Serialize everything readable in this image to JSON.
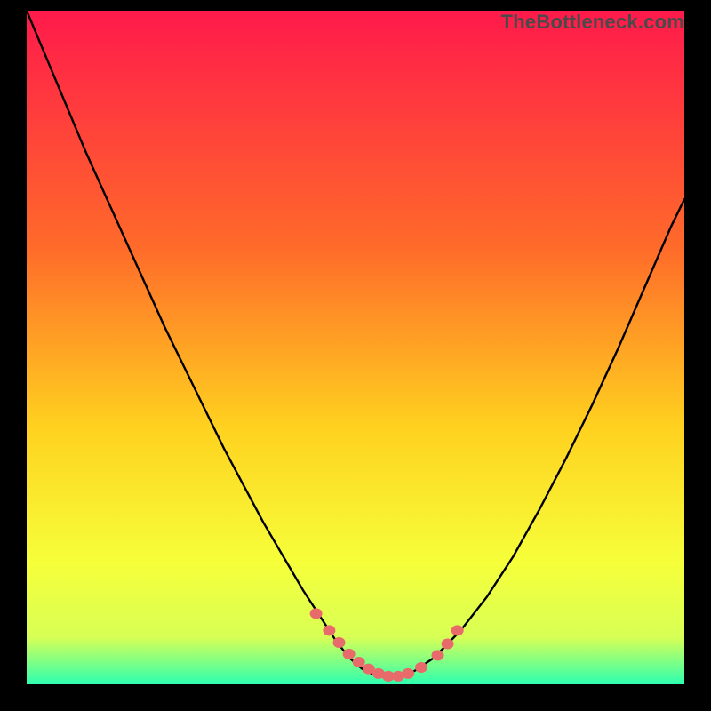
{
  "watermark": "TheBottleneck.com",
  "colors": {
    "gradient_top": "#ff1a4b",
    "gradient_upper_mid": "#ff6a2a",
    "gradient_mid": "#ffd21f",
    "gradient_lower_mid": "#f6ff3a",
    "gradient_near_bottom": "#d8ff55",
    "gradient_bottom": "#2dffb0",
    "curve": "#000000",
    "marker_fill": "#e96a6a",
    "marker_stroke": "#c94f4f"
  },
  "chart_data": {
    "type": "line",
    "title": "",
    "xlabel": "",
    "ylabel": "",
    "xlim": [
      0,
      100
    ],
    "ylim": [
      0,
      100
    ],
    "x": [
      0,
      3,
      6,
      9,
      12,
      15,
      18,
      21,
      24,
      27,
      30,
      33,
      36,
      39,
      42,
      45,
      47,
      49,
      51,
      53,
      55,
      57,
      59,
      62,
      66,
      70,
      74,
      78,
      82,
      86,
      90,
      94,
      98,
      100
    ],
    "y": [
      100,
      93,
      86,
      79,
      72.5,
      66,
      59.5,
      53,
      47,
      41,
      35,
      29.5,
      24,
      19,
      14,
      9.5,
      6.5,
      4,
      2.3,
      1.3,
      1,
      1.2,
      2,
      4,
      8,
      13,
      19,
      26,
      33.5,
      41.5,
      50,
      59,
      68,
      72
    ],
    "markers": {
      "x": [
        44,
        46,
        47.5,
        49,
        50.5,
        52,
        53.5,
        55,
        56.5,
        58,
        60,
        62.5,
        64,
        65.5
      ],
      "y": [
        10.5,
        8,
        6.2,
        4.5,
        3.3,
        2.3,
        1.6,
        1.2,
        1.2,
        1.6,
        2.5,
        4.3,
        6,
        8
      ]
    }
  }
}
